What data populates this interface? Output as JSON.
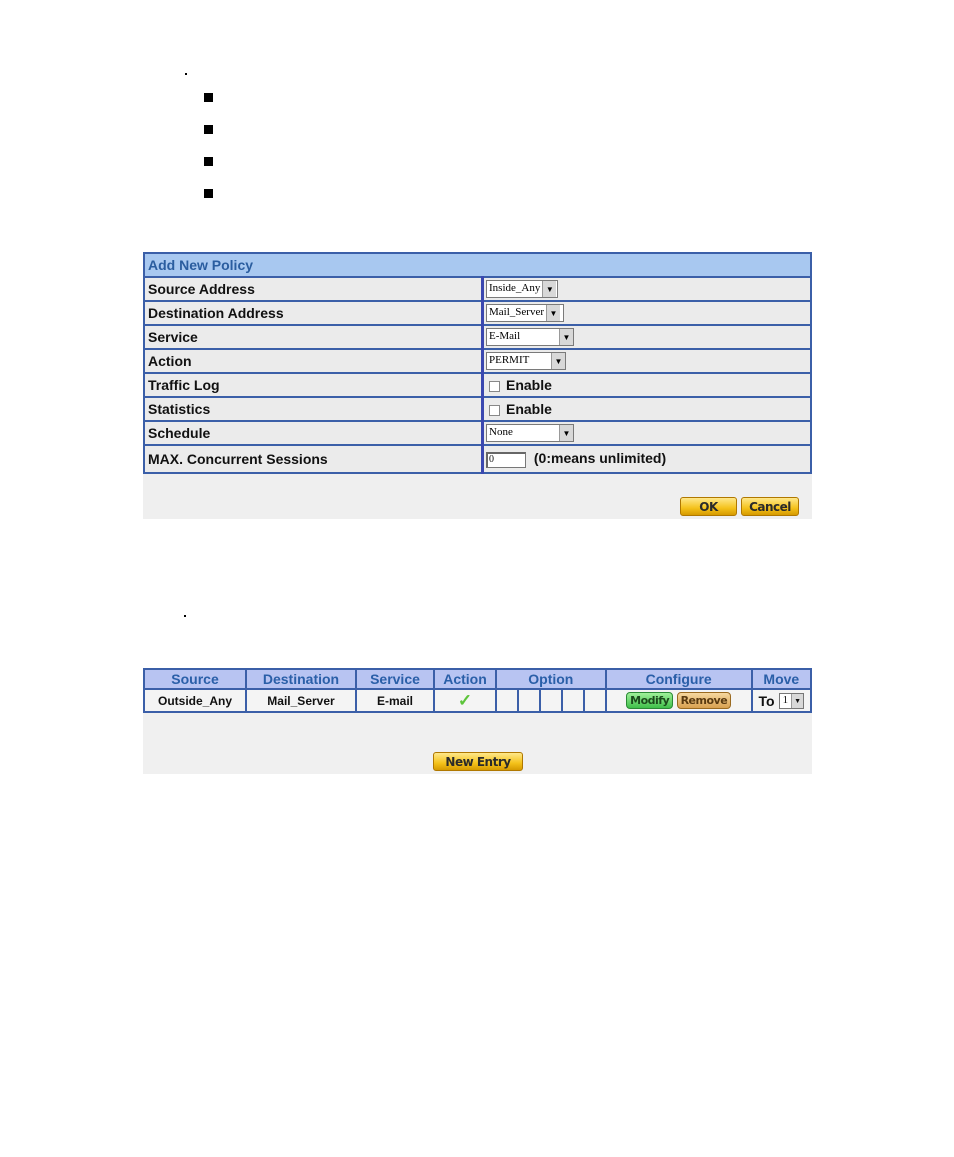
{
  "add_policy": {
    "title": "Add New Policy",
    "rows": [
      {
        "label": "Source Address",
        "type": "select",
        "value": "Inside_Any"
      },
      {
        "label": "Destination Address",
        "type": "select",
        "value": "Mail_Server"
      },
      {
        "label": "Service",
        "type": "select",
        "value": "E-Mail"
      },
      {
        "label": "Action",
        "type": "select",
        "value": "PERMIT"
      },
      {
        "label": "Traffic Log",
        "type": "checkbox",
        "value": "Enable",
        "checked": false
      },
      {
        "label": "Statistics",
        "type": "checkbox",
        "value": "Enable",
        "checked": false
      },
      {
        "label": "Schedule",
        "type": "select",
        "value": "None"
      },
      {
        "label": "MAX. Concurrent Sessions",
        "type": "text",
        "value": "0",
        "hint": "(0:means unlimited)"
      }
    ],
    "ok_label": "OK",
    "cancel_label": "Cancel"
  },
  "policy_list": {
    "headers": [
      "Source",
      "Destination",
      "Service",
      "Action",
      "Option",
      "Configure",
      "Move"
    ],
    "rows": [
      {
        "source": "Outside_Any",
        "destination": "Mail_Server",
        "service": "E-mail",
        "action": "permit-check",
        "modify_label": "Modify",
        "remove_label": "Remove",
        "move_prefix": "To",
        "move_value": "1"
      }
    ],
    "new_entry_label": "New Entry"
  },
  "icons": {
    "dropdown_arrow": "▼",
    "action_permit": "✓"
  }
}
